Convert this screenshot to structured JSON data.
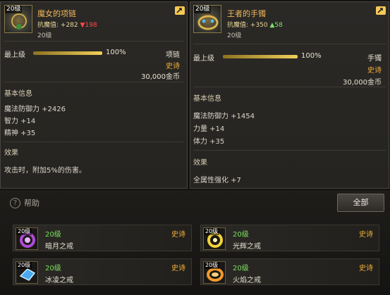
{
  "left_item": {
    "icon_level": "20级",
    "name": "魔女的项链",
    "stat_label": "抗魔值: ",
    "stat_value": "+282",
    "stat_change": "▼198",
    "level": "20级",
    "max_label": "最上级",
    "progress_text": "100%",
    "progress_fraction": 1.0,
    "item_type": "项链",
    "rarity": "史诗",
    "price": "30,000金币",
    "basic_info_title": "基本信息",
    "attributes": [
      "魔法防御力 +2426",
      "智力 +14",
      "精神 +35"
    ],
    "effect_title": "效果",
    "effect_text": "攻击时，附加5%的伤害。"
  },
  "right_item": {
    "icon_level": "20级",
    "name": "王者的手镯",
    "stat_label": "抗魔值: ",
    "stat_value": "+350",
    "stat_change": "▲58",
    "level": "20级",
    "max_label": "最上级",
    "progress_text": "100%",
    "progress_fraction": 1.0,
    "item_type": "手镯",
    "rarity": "史诗",
    "price": "30,000金币",
    "basic_info_title": "基本信息",
    "attributes": [
      "魔法防御力 +1454",
      "力量 +14",
      "体力 +35"
    ],
    "effect_title": "效果",
    "effect_text": "全属性强化 +7"
  },
  "bottom": {
    "help_label": "帮助",
    "all_button": "全部",
    "rings": [
      {
        "icon_level": "20级",
        "level": "20级",
        "rarity": "史诗",
        "name": "暗月之戒",
        "icon": "purple-ring-icon",
        "color": "#b04ad8"
      },
      {
        "icon_level": "20级",
        "level": "20级",
        "rarity": "史诗",
        "name": "光辉之戒",
        "icon": "golden-ring-icon",
        "color": "#f2d33a"
      },
      {
        "icon_level": "20级",
        "level": "20级",
        "rarity": "史诗",
        "name": "冰凌之戒",
        "icon": "ice-ring-icon",
        "color": "#4aa8f0"
      },
      {
        "icon_level": "20级",
        "level": "20级",
        "rarity": "史诗",
        "name": "火焰之戒",
        "icon": "fire-ring-icon",
        "color": "#f29a2a"
      }
    ]
  },
  "colors": {
    "name": "#f0b65a",
    "rarity": "#f2b03a",
    "level_green": "#7be05d",
    "stat_up": "#7ee06a",
    "stat_down": "#ff4a4a"
  }
}
